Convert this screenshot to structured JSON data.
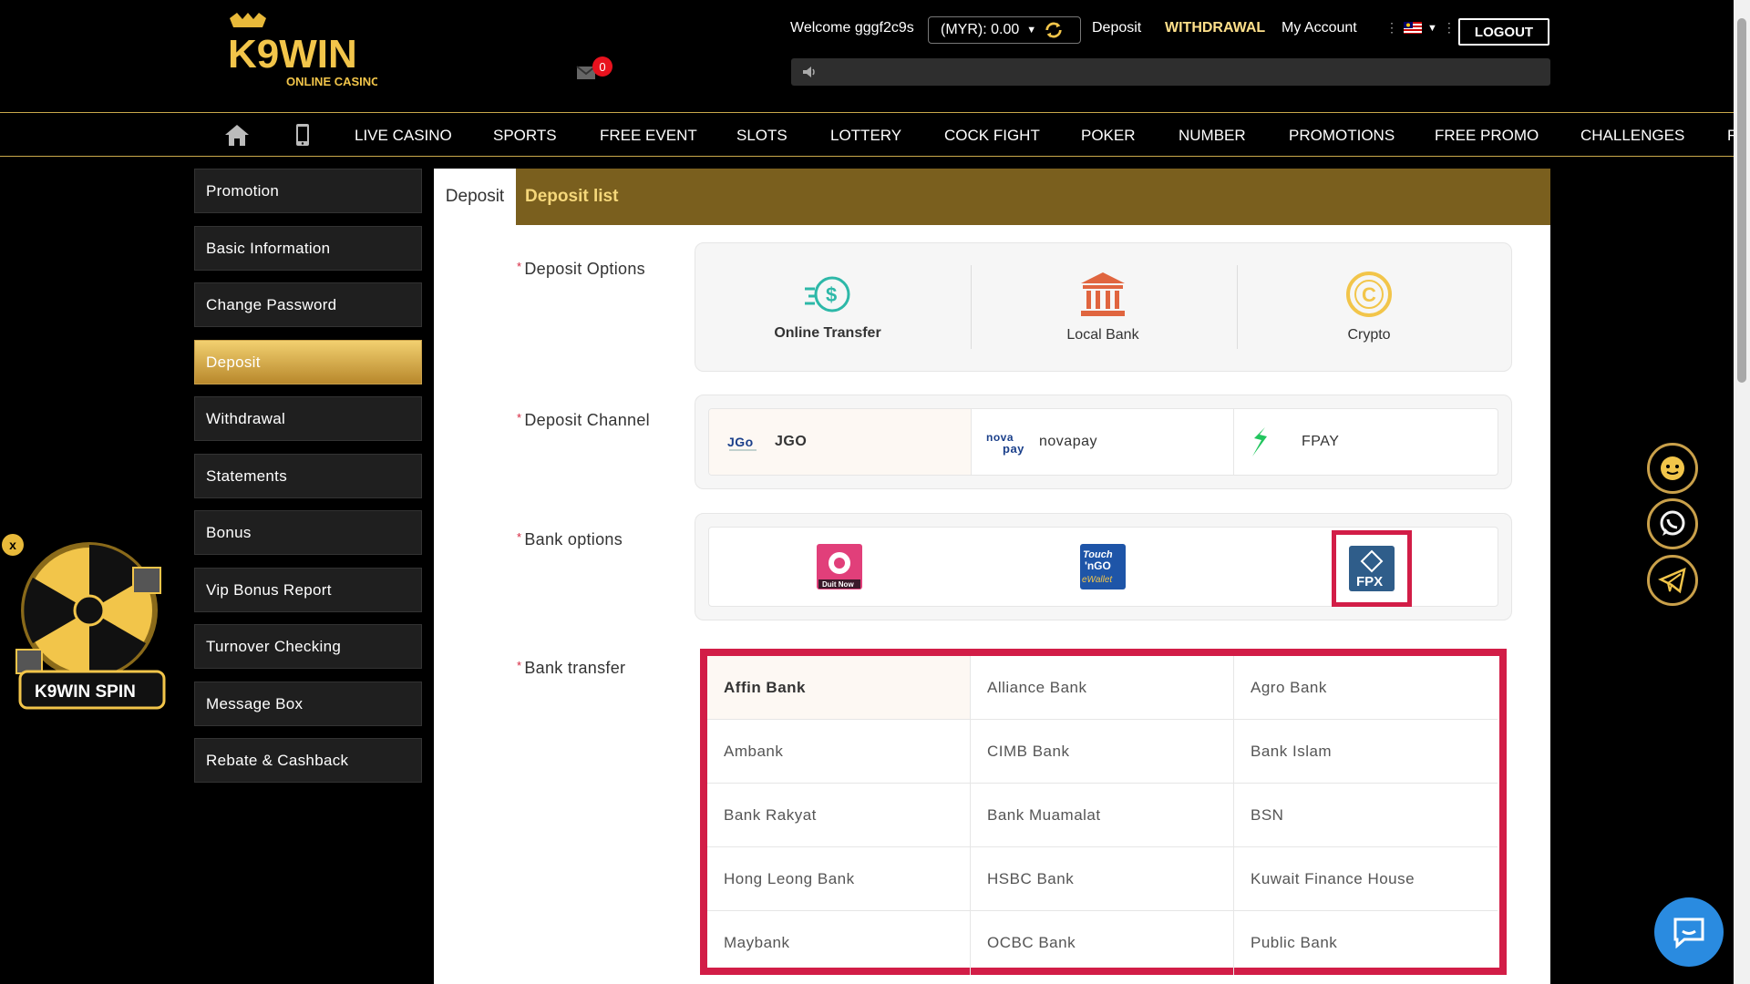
{
  "header": {
    "logo_text": "K9WIN",
    "logo_subtext": "ONLINE CASINO",
    "welcome": "Welcome gggf2c9s",
    "balance": "(MYR): 0.00",
    "links": {
      "deposit": "Deposit",
      "withdrawal": "WITHDRAWAL",
      "my_account": "My Account"
    },
    "logout": "LOGOUT",
    "mail_count": "0"
  },
  "nav": {
    "items": [
      "LIVE CASINO",
      "SPORTS",
      "FREE EVENT",
      "SLOTS",
      "LOTTERY",
      "COCK FIGHT",
      "POKER",
      "NUMBER",
      "PROMOTIONS",
      "FREE PROMO",
      "CHALLENGES",
      "F"
    ]
  },
  "sidebar": {
    "items": [
      "Promotion",
      "Basic Information",
      "Change Password",
      "Deposit",
      "Withdrawal",
      "Statements",
      "Bonus",
      "Vip Bonus Report",
      "Turnover Checking",
      "Message Box",
      "Rebate & Cashback"
    ],
    "active": "Deposit"
  },
  "tabs": {
    "deposit": "Deposit",
    "deposit_list": "Deposit list"
  },
  "form": {
    "deposit_options_label": "Deposit Options",
    "deposit_channel_label": "Deposit Channel",
    "bank_options_label": "Bank options",
    "bank_transfer_label": "Bank transfer",
    "required_mark": "*",
    "deposit_options": [
      "Online Transfer",
      "Local Bank",
      "Crypto"
    ],
    "selected_option": "Online Transfer",
    "channels": [
      "JGO",
      "novapay",
      "FPAY"
    ],
    "selected_channel": "JGO",
    "channel_logos": {
      "novapay_top": "nova",
      "novapay_bottom": "pay"
    },
    "bank_option_logos": [
      "DuitNow",
      "Touch 'n Go eWallet",
      "FPX"
    ],
    "selected_bank_option": "FPX",
    "logo_text": {
      "duitnow": "Duit Now",
      "tng_top": "Touch",
      "tng_mid": "'nGO",
      "tng_bottom": "eWallet",
      "fpx": "FPX"
    },
    "banks": [
      [
        "Affin Bank",
        "Alliance Bank",
        "Agro Bank"
      ],
      [
        "Ambank",
        "CIMB Bank",
        "Bank Islam"
      ],
      [
        "Bank Rakyat",
        "Bank Muamalat",
        "BSN"
      ],
      [
        "Hong Leong Bank",
        "HSBC Bank",
        "Kuwait Finance House"
      ],
      [
        "Maybank",
        "OCBC Bank",
        "Public Bank"
      ]
    ],
    "selected_bank": "Affin Bank"
  },
  "spin": {
    "label": "K9WIN SPIN",
    "close": "x"
  },
  "colors": {
    "accent_gold": "#c9a04a",
    "highlight_red": "#d21d47",
    "tab_bar": "#7a5f1e",
    "chat_blue": "#2a8be0"
  }
}
